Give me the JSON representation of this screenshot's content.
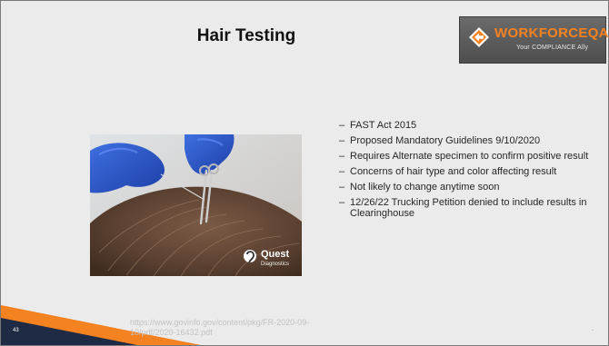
{
  "slide": {
    "title": "Hair Testing",
    "number": "43",
    "source_url": "https://www.govinfo.gov/content/pkg/FR-2020-09-10/pdf/2020-16432.pdf",
    "trailing_mark": "."
  },
  "logo": {
    "name": "WORKFORCEQA",
    "tagline": "Your COMPLIANCE Ally",
    "icon": "arrow-diamond-icon",
    "colors": {
      "accent": "#f58220",
      "background": "#5e5e5e"
    }
  },
  "photo": {
    "watermark_brand": "Quest",
    "watermark_sub": "Diagnostics",
    "icon": "quest-logo-icon"
  },
  "bullets": [
    {
      "marker": "–",
      "text": "FAST Act 2015"
    },
    {
      "marker": "–",
      "text": "Proposed Mandatory Guidelines 9/10/2020"
    },
    {
      "marker": "–",
      "text": "Requires Alternate specimen to confirm positive result"
    },
    {
      "marker": "–",
      "text": "Concerns of hair type and color affecting result"
    },
    {
      "marker": "–",
      "text": "Not likely to change anytime soon"
    },
    {
      "marker": "–",
      "text": "12/26/22 Trucking Petition denied to include results in Clearinghouse"
    }
  ],
  "theme": {
    "background": "#ebebeb",
    "corner_orange": "#f58220",
    "corner_navy": "#1f2a44"
  }
}
